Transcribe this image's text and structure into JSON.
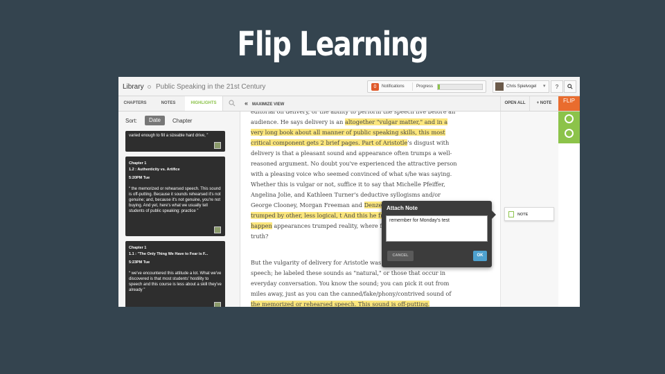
{
  "slide": {
    "title": "Flip Learning"
  },
  "topbar": {
    "library": "Library",
    "book_title": "Public Speaking in the 21st Century",
    "notifications_count": "0",
    "notifications_label": "Notifications",
    "progress_label": "Progress",
    "progress_value": 0.04,
    "user_name": "Chris Spielvogel",
    "user_caret": "▾",
    "help": "?",
    "search_icon": "search-icon"
  },
  "tabs": {
    "chapters": "CHAPTERS",
    "notes": "NOTES",
    "highlights": "HIGHLIGHTS",
    "maximize_chevron": "«",
    "maximize": "MAXIMIZE VIEW",
    "open_all": "OPEN ALL",
    "add_note": "+ NOTE",
    "flip_logo": "FLIP"
  },
  "sidebar": {
    "sort_label": "Sort:",
    "sort_date": "Date",
    "sort_chapter": "Chapter",
    "cards": [
      {
        "text": "varied enough to fill a sizeable hard drive, ”"
      },
      {
        "chapter": "Chapter 1",
        "section": "1.2 : Authenticity vs. Artifice",
        "time": "5:20PM Tue",
        "text": "“ the memorized or rehearsed speech. This sound is off-putting. Because it sounds rehearsed it's not genuine; and, because it's not genuine, you're not buying. And yet, here's what we usually tell students of public speaking: practice ”"
      },
      {
        "chapter": "Chapter 1",
        "section": "1.1 : \"The Only Thing We Have to Fear is F...",
        "time": "5:23PM Tue",
        "text": "“ we've encountered this attitude a lot. What we've discovered is that most students' hostility to speech and this course is less about a skill they've already ”"
      }
    ]
  },
  "reading": {
    "p1_a": "editorial on delivery, or the ability to perform the speech live before an audience. He says delivery is an ",
    "p1_hl1": "altogether \"vulgar matter,\" and in a very long book about all manner of public speaking skills, this most critical component gets 2 brief pages. Part of Aristotle",
    "p1_b": "'s disgust with delivery is that a pleasant sound and appearance often trumps a well-reasoned argument. No doubt you've experienced the attractive person with a pleasing voice who seemed convinced of what s/he was saying. Whether this is vulgar or not, suffice it to say that Michelle Pfeiffer, Angelina Jolie, and Kathleen Turner's deductive syllogisms and/or George Clooney, Morgan Freeman and ",
    "p1_hl2": "Denzell Washi",
    "p1_c": " ",
    "p1_hl3": "inferences get trumped by other, less logical, t And this he fretted about. What would happen",
    "p1_d": " appearances trumped reality, where falsehood overwhelm truth?",
    "p2_a": "But the vulgarity of delivery for Aristotle was a pleasing sounds of speech; he labeled these sounds as \"natural,\" or those that occur in everyday conversation. You know the sound; you can pick it out from miles away, just as you can the canned/fake/phony/contrived sound of ",
    "p2_hl": "the memorized or rehearsed speech. This sound is off-putting."
  },
  "notes_col": {
    "note_label": "NOTE"
  },
  "popup": {
    "title": "Attach Note",
    "note_value": "remember for Monday's test",
    "cancel": "CANCEL",
    "ok": "OK"
  },
  "colors": {
    "accent_green": "#8cc34a",
    "highlight": "#fbe67d",
    "flip_orange": "#e96c2e",
    "ok_blue": "#4ea1cf"
  }
}
